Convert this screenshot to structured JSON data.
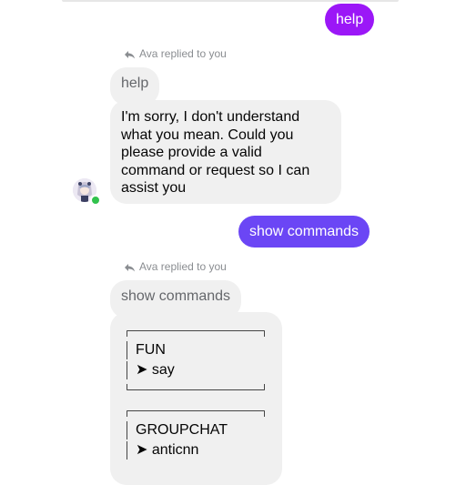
{
  "colors": {
    "outgoing_help": "#9b17f7",
    "outgoing_commands": "#6b46f5",
    "incoming": "#f0f0f0",
    "online": "#31c24d"
  },
  "messages": {
    "out_help": "help",
    "reply_note_1": "Ava replied to you",
    "quoted_1": "help",
    "in_1_lines": [
      "I'm sorry, I don't understand",
      "what you mean. Could you",
      "please provide a valid",
      "command or request so I can",
      "assist you"
    ],
    "out_commands": "show commands",
    "reply_note_2": "Ava replied to you",
    "quoted_2": "show commands",
    "commands": [
      {
        "group": "FUN",
        "item": "➤ say"
      },
      {
        "group": "GROUPCHAT",
        "item": "➤ anticnn"
      }
    ]
  },
  "icons": {
    "reply": "reply-arrow-icon",
    "avatar": "avatar",
    "status": "online-status-icon"
  }
}
